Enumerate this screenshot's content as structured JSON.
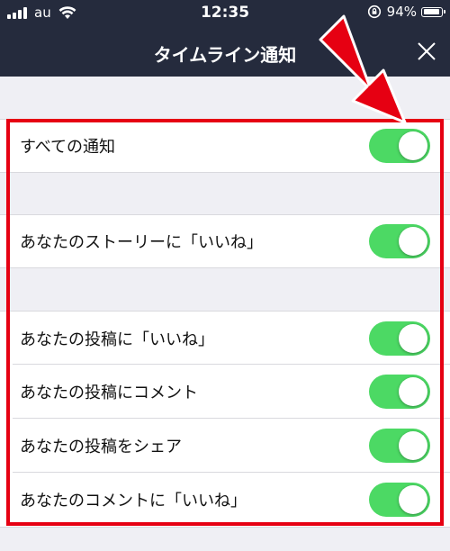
{
  "status": {
    "carrier": "au",
    "time": "12:35",
    "battery": "94%",
    "battery_level": 0.94
  },
  "nav": {
    "title": "タイムライン通知",
    "close_icon": "close-icon"
  },
  "settings": [
    {
      "label": "すべての通知",
      "on": true
    },
    {
      "label": "あなたのストーリーに「いいね」",
      "on": true
    },
    {
      "label": "あなたの投稿に「いいね」",
      "on": true
    },
    {
      "label": "あなたの投稿にコメント",
      "on": true
    },
    {
      "label": "あなたの投稿をシェア",
      "on": true
    },
    {
      "label": "あなたのコメントに「いいね」",
      "on": true
    }
  ],
  "colors": {
    "nav_bg": "#252b3d",
    "toggle_on": "#4cd964",
    "highlight": "#e60012",
    "page_bg": "#efeff4"
  }
}
